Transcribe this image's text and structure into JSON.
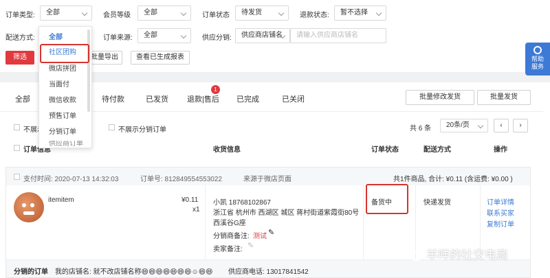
{
  "filters": {
    "order_type_label": "订单类型:",
    "order_type_value": "全部",
    "member_level_label": "会员等级",
    "member_level_value": "全部",
    "order_status_label": "订单状态",
    "order_status_value": "待发货",
    "refund_status_label": "退款状态:",
    "refund_status_value": "暂不选择",
    "delivery_label": "配送方式:",
    "source_label": "订单来源:",
    "source_value": "全部",
    "supplier_label": "供应分销:",
    "supplier_value": "供应商店铺名",
    "supplier_placeholder": "请输入供应商店铺名"
  },
  "actions": {
    "filter": "筛选",
    "batch_export": "批量导出",
    "view_reports": "查看已生成报表"
  },
  "dropdown": {
    "items": [
      "全部",
      "社区团购",
      "微店拼团",
      "当面付",
      "微信收款",
      "预售订单",
      "分销订单",
      "供应商订单"
    ]
  },
  "help": {
    "label1": "帮助",
    "label2": "服务"
  },
  "tabs": {
    "items": [
      "全部",
      "待付款",
      "已发货",
      "退款|售后",
      "已完成",
      "已关闭"
    ],
    "badge": "1",
    "batch_modify": "批量修改发货",
    "batch_ship": "批量发货"
  },
  "options": {
    "hide_partial": "不展示",
    "hide_dist": "不展示分销订单",
    "total": "共 6 条",
    "per_page": "20条/页"
  },
  "table": {
    "col_order_info": "订单信息",
    "col_receiver": "收货信息",
    "col_status": "订单状态",
    "col_delivery": "配送方式",
    "col_action": "操作"
  },
  "order": {
    "pay_time": "支付时间: 2020-07-13 14:32:03",
    "order_no": "订单号: 812849554553022",
    "source": "来源于微店页面",
    "summary": "共1件商品, 合计: ¥0.11 (含运费: ¥0.00 )",
    "item_name": "itemitem",
    "price": "¥0.11",
    "qty": "x1",
    "receiver_name": "小凯 18768102867",
    "address_1": "浙江省 杭州市 西湖区 城区 蒋村街道紫霞街80号",
    "address_2": "西溪谷G座",
    "dist_note_label": "分销商备注:",
    "dist_note_value": "测试",
    "seller_note_label": "卖家备注:",
    "status": "备货中",
    "delivery": "快递发货",
    "act_detail": "订单详情",
    "act_contact": "联系买家",
    "act_copy": "复制订单",
    "footer_dist": "分销的订单",
    "footer_shop": "我的店铺名: 就不改店铺名称😄😄😄😄😄😄😄☺😄😄",
    "footer_phone": "供应商电话: 13017841542"
  },
  "watermark": "羊咩的社交电商",
  "colors": {
    "accent_red": "#e0393e",
    "link_blue": "#3a7bd5",
    "help_blue": "#3d7ad6"
  }
}
